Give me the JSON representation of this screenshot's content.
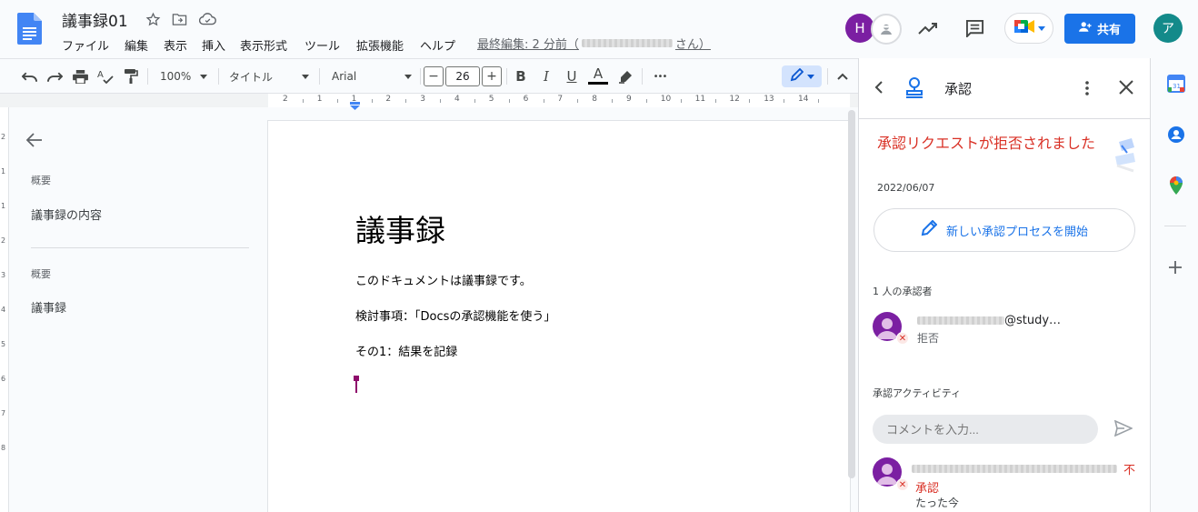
{
  "app": {
    "doc_title": "議事録01",
    "menu": [
      "ファイル",
      "編集",
      "表示",
      "挿入",
      "表示形式",
      "ツール",
      "拡張機能",
      "ヘルプ"
    ],
    "last_edit_prefix": "最終編集: 2 分前（",
    "last_edit_suffix": "さん）",
    "avatar_letter": "H",
    "share_label": "共有",
    "account_letter": "ア"
  },
  "toolbar": {
    "zoom": "100%",
    "style": "タイトル",
    "font": "Arial",
    "minus": "−",
    "font_size": "26",
    "plus": "+",
    "bold": "B",
    "italic": "I",
    "underline": "U",
    "text_color": "A",
    "more": "•••"
  },
  "ruler": {
    "labels": [
      "2",
      "1",
      "1",
      "2",
      "3",
      "4",
      "5",
      "6",
      "7",
      "8",
      "9",
      "10",
      "11",
      "12",
      "13",
      "14"
    ],
    "vlabels": [
      "2",
      "1",
      "1",
      "2",
      "3",
      "4",
      "5",
      "6",
      "7",
      "8"
    ]
  },
  "outline": {
    "heading1": "概要",
    "item1": "議事録の内容",
    "heading2": "概要",
    "item2": "議事録"
  },
  "document": {
    "title": "議事録",
    "p1": "このドキュメントは議事録です。",
    "p2": "検討事項：「Docsの承認機能を使う」",
    "p3": "その1：結果を記録"
  },
  "panel": {
    "title": "承認",
    "status_title": "承認リクエストが拒否されました",
    "date": "2022/06/07",
    "new_button": "新しい承認プロセスを開始",
    "approvers_label": "1 人の承認者",
    "approver_email_suffix": "@study…",
    "approver_status": "拒否",
    "activity_label": "承認アクティビティ",
    "comment_placeholder": "コメントを入力...",
    "activity_status": "不",
    "activity_status2": "承認",
    "activity_time": "たった今"
  },
  "colors": {
    "accent": "#1a73e8",
    "rejected": "#d93025",
    "avatar": "#7b1fa2",
    "account": "#138a8a"
  },
  "icons": [
    "docs-logo-icon",
    "star-icon",
    "move-folder-icon",
    "cloud-icon",
    "trending-icon",
    "comment-icon",
    "meet-icon",
    "person-add-icon",
    "undo-icon",
    "redo-icon",
    "print-icon",
    "spellcheck-icon",
    "paint-format-icon",
    "highlight-icon",
    "edit-mode-icon",
    "collapse-icon",
    "back-arrow-icon",
    "approval-icon",
    "more-vert-icon",
    "close-icon",
    "pencil-icon",
    "send-icon",
    "calendar-icon",
    "contacts-icon",
    "maps-icon",
    "add-icon"
  ]
}
